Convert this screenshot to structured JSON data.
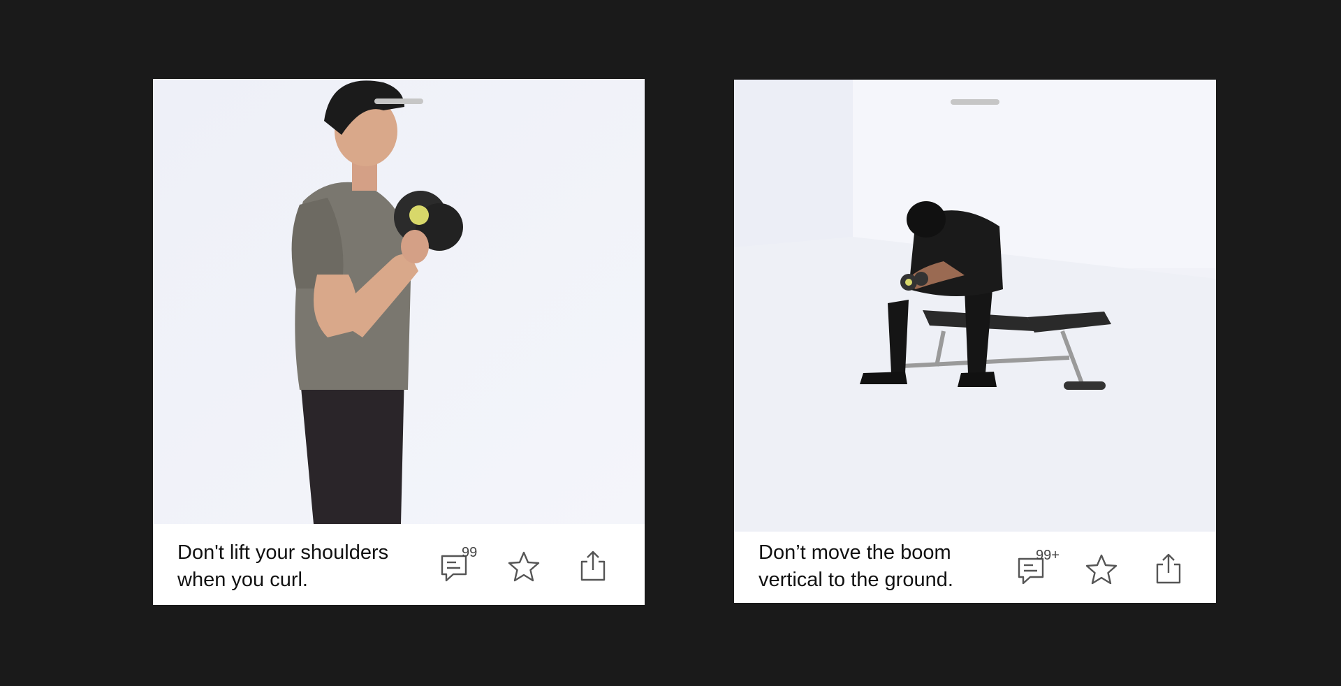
{
  "cards": [
    {
      "caption_line1": "Don't lift your shoulders",
      "caption_line2": "when you curl.",
      "comment_count": "99",
      "media_description_icon": "standing-dumbbell-curl-image"
    },
    {
      "caption_line1": "Don’t move the boom",
      "caption_line2": "vertical to the ground.",
      "comment_count": "99+",
      "media_description_icon": "seated-concentration-curl-image"
    }
  ],
  "icons": {
    "comment": "comment-icon",
    "favorite": "star-icon",
    "share": "share-icon"
  },
  "colors": {
    "page_background": "#1a1a1a",
    "card_background": "#ffffff",
    "icon_stroke": "#555555"
  }
}
